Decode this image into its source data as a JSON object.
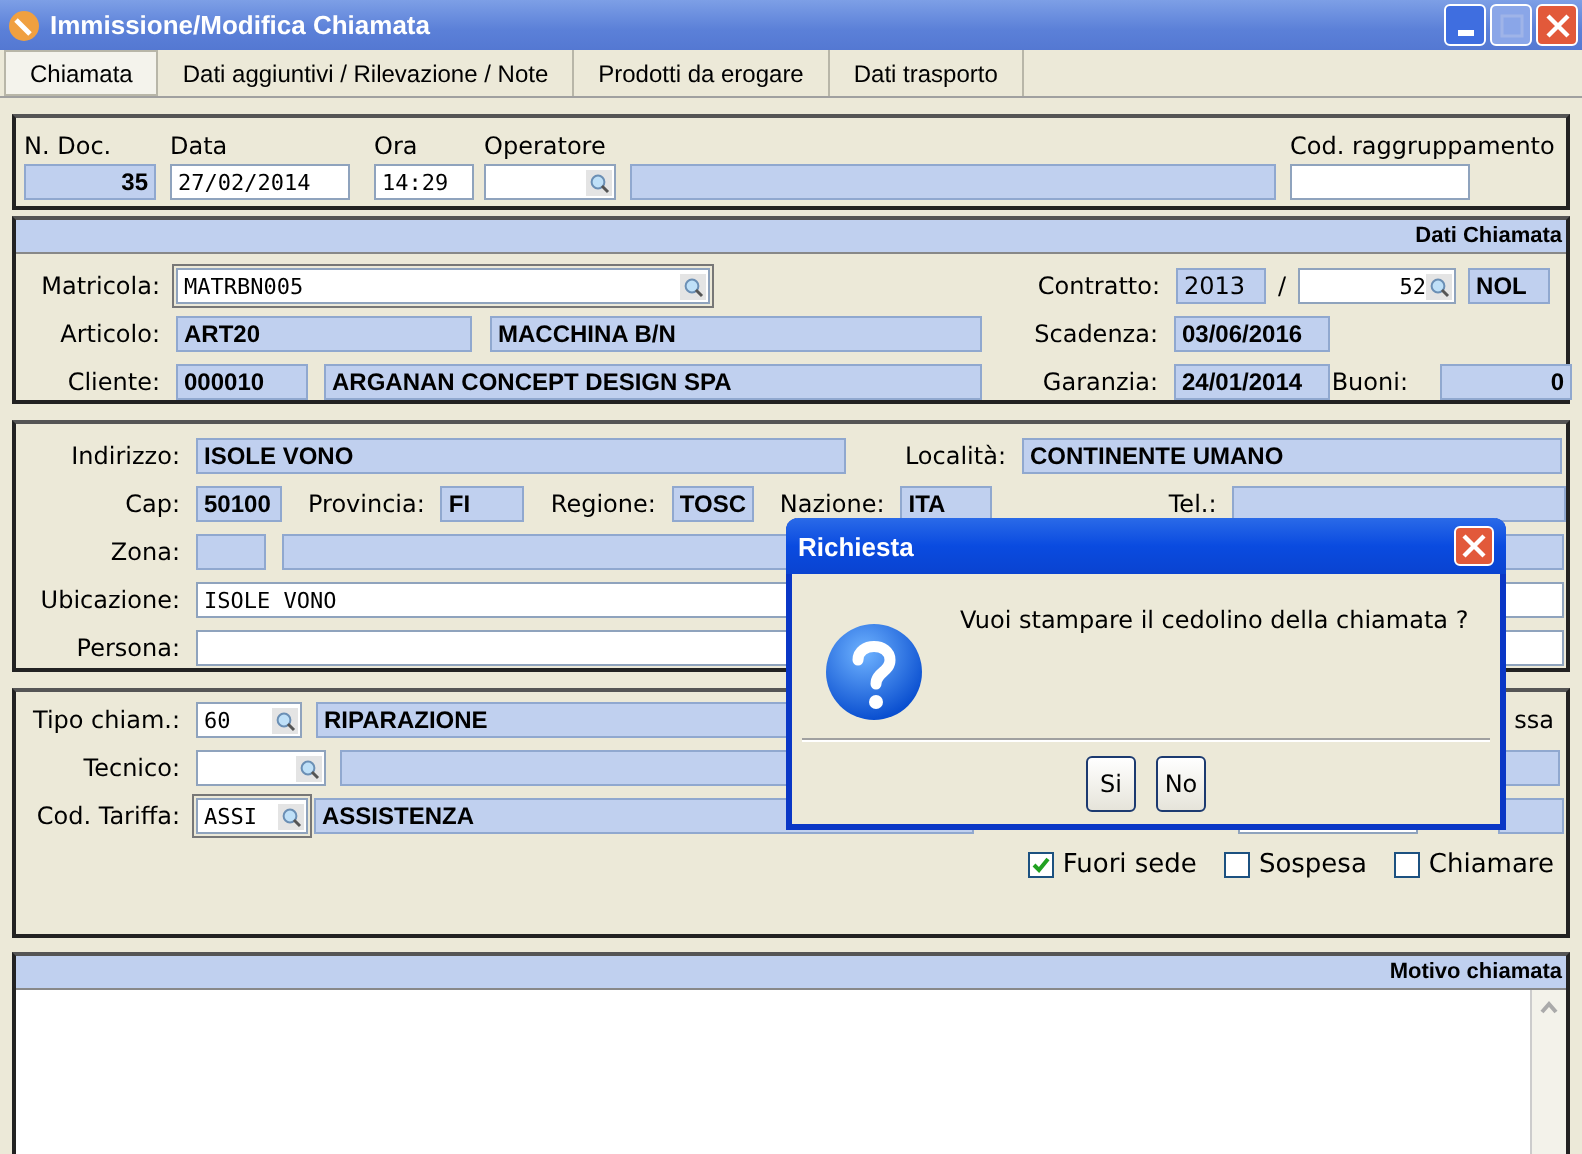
{
  "window": {
    "title": "Immissione/Modifica Chiamata"
  },
  "tabs": [
    {
      "label": "Chiamata",
      "selected": true
    },
    {
      "label": "Dati aggiuntivi / Rilevazione / Note",
      "selected": false
    },
    {
      "label": "Prodotti da erogare",
      "selected": false
    },
    {
      "label": "Dati trasporto",
      "selected": false
    }
  ],
  "header": {
    "doc_no": {
      "label": "N. Doc.",
      "value": "35"
    },
    "date": {
      "label": "Data",
      "value": "27/02/2014"
    },
    "time": {
      "label": "Ora",
      "value": "14:29"
    },
    "operator": {
      "label": "Operatore"
    },
    "group_code": {
      "label": "Cod. raggruppamento"
    }
  },
  "call_data": {
    "title": "Dati Chiamata",
    "matricola": {
      "label": "Matricola:",
      "value": "MATRBN005"
    },
    "contratto": {
      "label": "Contratto:",
      "year": "2013",
      "separator": "/",
      "number": "52",
      "type": "NOL"
    },
    "articolo": {
      "label": "Articolo:",
      "code": "ART20",
      "description": "MACCHINA B/N"
    },
    "scadenza": {
      "label": "Scadenza:",
      "value": "03/06/2016"
    },
    "cliente": {
      "label": "Cliente:",
      "code": "000010",
      "name": "ARGANAN CONCEPT DESIGN SPA"
    },
    "garanzia": {
      "label": "Garanzia:",
      "value": "24/01/2014"
    },
    "buoni": {
      "label": "Buoni:",
      "value": "0"
    }
  },
  "address": {
    "indirizzo": {
      "label": "Indirizzo:",
      "value": "ISOLE VONO"
    },
    "localita": {
      "label": "Località:",
      "value": "CONTINENTE UMANO"
    },
    "cap": {
      "label": "Cap:",
      "value": "50100"
    },
    "provincia": {
      "label": "Provincia:",
      "value": "FI"
    },
    "regione": {
      "label": "Regione:",
      "value": "TOSC"
    },
    "nazione": {
      "label": "Nazione:",
      "value": "ITA"
    },
    "tel": {
      "label": "Tel.:"
    },
    "zona": {
      "label": "Zona:"
    },
    "ubicazione": {
      "label": "Ubicazione:",
      "value": "ISOLE VONO"
    },
    "persona": {
      "label": "Persona:"
    }
  },
  "call": {
    "tipo": {
      "label": "Tipo chiam.:",
      "code": "60",
      "description": "RIPARAZIONE"
    },
    "right_label_tail": "ssa",
    "tecnico": {
      "label": "Tecnico:"
    },
    "tariffa": {
      "label": "Cod. Tariffa:",
      "code": "ASSI",
      "description": "ASSISTENZA"
    },
    "checkboxes": [
      {
        "label": "Fuori sede",
        "checked": true
      },
      {
        "label": "Sospesa",
        "checked": false
      },
      {
        "label": "Chiamare",
        "checked": false
      }
    ]
  },
  "reason": {
    "title": "Motivo chiamata"
  },
  "dialog": {
    "title": "Richiesta",
    "message": "Vuoi stampare il cedolino della chiamata ?",
    "buttons": [
      "Si",
      "No"
    ]
  }
}
